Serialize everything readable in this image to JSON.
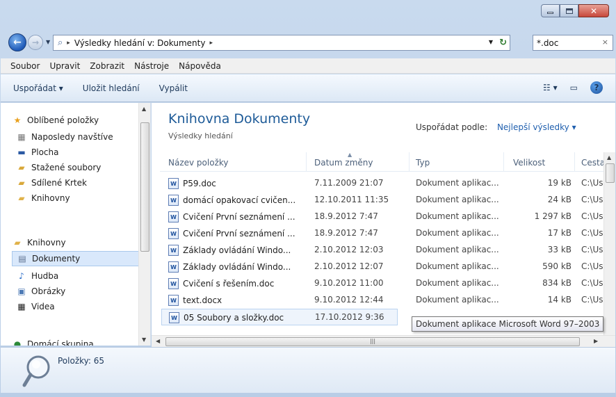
{
  "window": {
    "caption_buttons": [
      "minimize-icon",
      "maximize-icon",
      "close-icon"
    ]
  },
  "address_bar": {
    "breadcrumb_sep": "▸",
    "location": "Výsledky hledání v: Dokumenty",
    "trailing_sep": "▸"
  },
  "search": {
    "value": "*.doc",
    "clear": "×"
  },
  "menu": {
    "items": [
      "Soubor",
      "Upravit",
      "Zobrazit",
      "Nástroje",
      "Nápověda"
    ]
  },
  "toolbar": {
    "organize": "Uspořádat ▾",
    "save_search": "Uložit hledání",
    "burn": "Vypálit",
    "views_icon": "views-icon",
    "preview_icon": "preview-pane-icon",
    "help": "?"
  },
  "navigation": {
    "favorites_header": "Oblíbené položky",
    "favorites": [
      "Naposledy navštíve",
      "Plocha",
      "Stažené soubory",
      "Sdílené Krtek",
      "Knihovny"
    ],
    "libraries_header": "Knihovny",
    "libraries": [
      "Dokumenty",
      "Hudba",
      "Obrázky",
      "Videa"
    ],
    "homegroup": "Domácí skupina"
  },
  "content": {
    "library_title": "Knihovna Dokumenty",
    "subtitle": "Výsledky hledání",
    "arrange_label": "Uspořádat podle:",
    "arrange_value": "Nejlepší výsledky ▾",
    "columns": [
      "Název položky",
      "Datum změny",
      "Typ",
      "Velikost",
      "Cesta"
    ],
    "rows": [
      {
        "name": "P59.doc",
        "date": "7.11.2009 21:07",
        "type": "Dokument aplikac...",
        "size": "19 kB",
        "path": "C:\\Us"
      },
      {
        "name": "domácí opakovací cvičen...",
        "date": "12.10.2011 11:35",
        "type": "Dokument aplikac...",
        "size": "24 kB",
        "path": "C:\\Us"
      },
      {
        "name": "Cvičení První seznámení ...",
        "date": "18.9.2012 7:47",
        "type": "Dokument aplikac...",
        "size": "1 297 kB",
        "path": "C:\\Us"
      },
      {
        "name": "Cvičení První seznámení ...",
        "date": "18.9.2012 7:47",
        "type": "Dokument aplikac...",
        "size": "17 kB",
        "path": "C:\\Us"
      },
      {
        "name": "Základy ovládání Windo...",
        "date": "2.10.2012 12:03",
        "type": "Dokument aplikac...",
        "size": "33 kB",
        "path": "C:\\Us"
      },
      {
        "name": "Základy ovládání Windo...",
        "date": "2.10.2012 12:07",
        "type": "Dokument aplikac...",
        "size": "590 kB",
        "path": "C:\\Us"
      },
      {
        "name": "Cvičení s řešením.doc",
        "date": "9.10.2012 11:00",
        "type": "Dokument aplikac...",
        "size": "834 kB",
        "path": "C:\\Us"
      },
      {
        "name": "text.docx",
        "date": "9.10.2012 12:44",
        "type": "Dokument aplikac...",
        "size": "14 kB",
        "path": "C:\\Us"
      },
      {
        "name": "05 Soubory a složky.doc",
        "date": "17.10.2012 9:36",
        "type": "",
        "size": "",
        "path": ""
      }
    ],
    "tooltip": "Dokument aplikace Microsoft Word 97–2003"
  },
  "details": {
    "count": "Položky: 65"
  },
  "colors": {
    "accent": "#1e5b98",
    "selection": "#d9e8fb",
    "link": "#1f5fae"
  }
}
